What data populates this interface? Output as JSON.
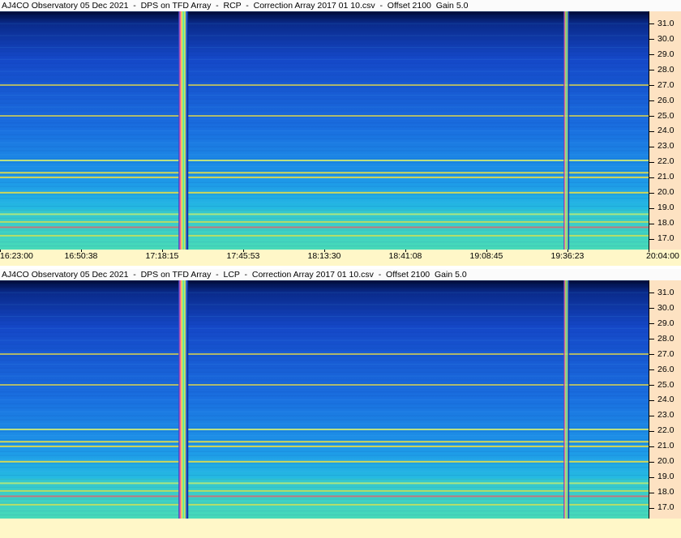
{
  "panels": [
    {
      "title": "AJ4CO Observatory 05 Dec 2021  -  DPS on TFD Array  -  RCP  -  Correction Array 2017 01 10.csv  -  Offset 2100  Gain 5.0",
      "has_time_axis": true
    },
    {
      "title": "AJ4CO Observatory 05 Dec 2021  -  DPS on TFD Array  -  LCP  -  Correction Array 2017 01 10.csv  -  Offset 2100  Gain 5.0",
      "has_time_axis": false
    }
  ],
  "chart_data": [
    {
      "type": "heatmap",
      "title": "AJ4CO Observatory 05 Dec 2021  -  DPS on TFD Array  -  RCP  -  Correction Array 2017 01 10.csv  -  Offset 2100  Gain 5.0",
      "polarization": "RCP",
      "x_ticks": [
        "16:23:00",
        "16:50:38",
        "17:18:15",
        "17:45:53",
        "18:13:30",
        "18:41:08",
        "19:08:45",
        "19:36:23",
        "20:04:00"
      ],
      "xlim": [
        "16:23:00",
        "20:04:00"
      ],
      "y_ticks": [
        17.0,
        18.0,
        19.0,
        20.0,
        21.0,
        22.0,
        23.0,
        24.0,
        25.0,
        26.0,
        27.0,
        28.0,
        29.0,
        30.0,
        31.0
      ],
      "y_tick_labels": [
        "17.0",
        "18.0",
        "19.0",
        "20.0",
        "21.0",
        "22.0",
        "23.0",
        "24.0",
        "25.0",
        "26.0",
        "27.0",
        "28.0",
        "29.0",
        "30.0",
        "31.0"
      ],
      "ylim": [
        16.3,
        31.8
      ],
      "colormap": [
        "#000a33",
        "#0a2a8a",
        "#1a60d8",
        "#22a8e8",
        "#3ad8c8",
        "#e8f040",
        "#ff4060"
      ],
      "interference_lines_mhz": [
        17.2,
        17.75,
        18.1,
        18.6,
        20.0,
        21.0,
        21.3,
        22.1,
        25.0,
        27.0
      ],
      "broadband_bursts": [
        "17:25:30",
        "19:36:00"
      ]
    },
    {
      "type": "heatmap",
      "title": "AJ4CO Observatory 05 Dec 2021  -  DPS on TFD Array  -  LCP  -  Correction Array 2017 01 10.csv  -  Offset 2100  Gain 5.0",
      "polarization": "LCP",
      "y_ticks": [
        17.0,
        18.0,
        19.0,
        20.0,
        21.0,
        22.0,
        23.0,
        24.0,
        25.0,
        26.0,
        27.0,
        28.0,
        29.0,
        30.0,
        31.0
      ],
      "y_tick_labels": [
        "17.0",
        "18.0",
        "19.0",
        "20.0",
        "21.0",
        "22.0",
        "23.0",
        "24.0",
        "25.0",
        "26.0",
        "27.0",
        "28.0",
        "29.0",
        "30.0",
        "31.0"
      ],
      "ylim": [
        16.3,
        31.8
      ],
      "colormap": [
        "#000a33",
        "#0a2a8a",
        "#1a60d8",
        "#22a8e8",
        "#3ad8c8",
        "#e8f040",
        "#ff4060"
      ],
      "interference_lines_mhz": [
        17.2,
        17.75,
        18.1,
        18.6,
        20.0,
        21.0,
        21.3,
        22.1,
        25.0,
        27.0
      ],
      "broadband_bursts": [
        "17:25:30",
        "19:36:00"
      ]
    }
  ]
}
